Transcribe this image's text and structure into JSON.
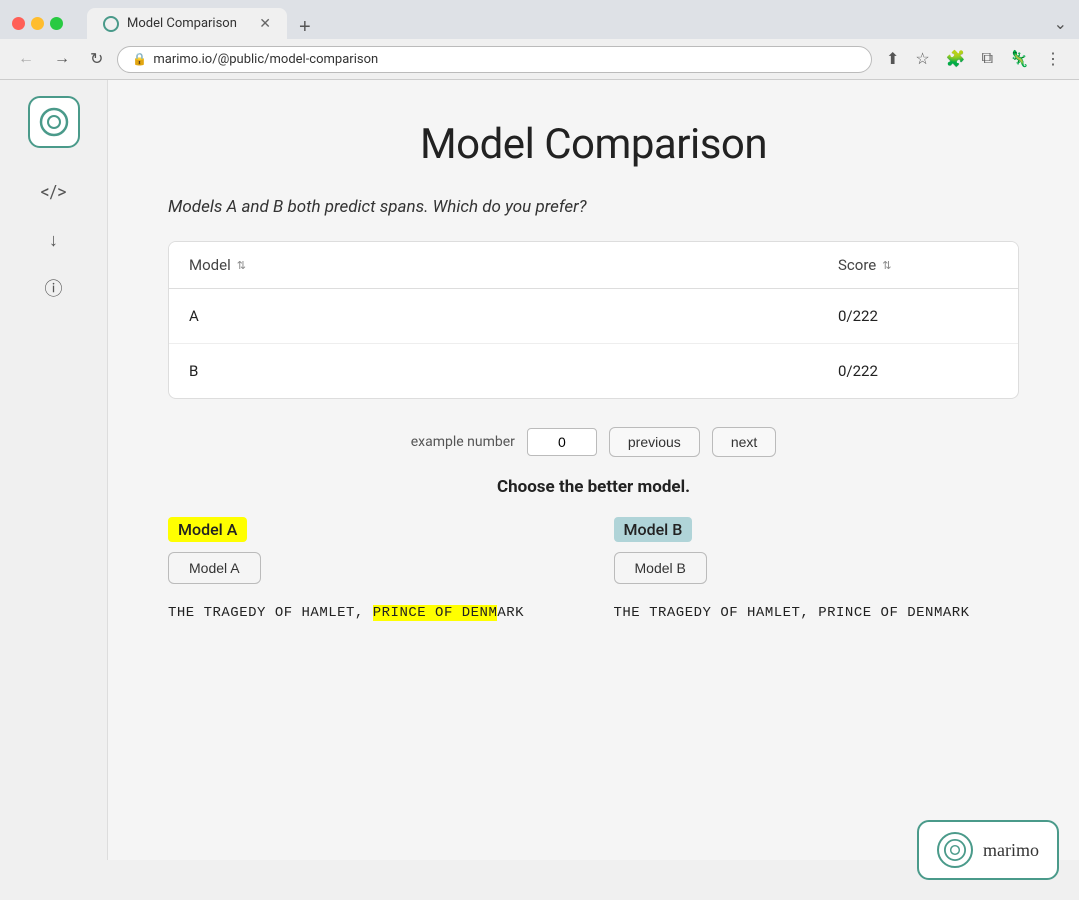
{
  "browser": {
    "tab_title": "Model Comparison",
    "url": "marimo.io/@public/model-comparison",
    "new_tab_label": "+",
    "tab_menu_label": "⌄"
  },
  "page": {
    "title": "Model Comparison",
    "subtitle": "Models A and B both predict spans. Which do you prefer?"
  },
  "table": {
    "col_model": "Model",
    "col_score": "Score",
    "rows": [
      {
        "model": "A",
        "score": "0/222"
      },
      {
        "model": "B",
        "score": "0/222"
      }
    ]
  },
  "controls": {
    "example_label": "example number",
    "example_value": "0",
    "previous_label": "previous",
    "next_label": "next"
  },
  "comparison": {
    "choose_label": "Choose the better model.",
    "model_a_label": "Model A",
    "model_b_label": "Model B",
    "model_a_btn": "Model A",
    "model_b_btn": "Model B",
    "model_a_text_before": "THE TRAGEDY OF HAMLET, ",
    "model_a_highlight": "PRINCE OF DENM",
    "model_a_text_after": "ARK",
    "model_b_text_before": "THE TRAGEDY OF HAMLET, PRINCE OF DENMARK",
    "model_b_highlight": ""
  },
  "sidebar": {
    "code_icon": "</>",
    "download_icon": "↓",
    "info_icon": "ⓘ"
  },
  "watermark": {
    "brand": "marimo"
  }
}
